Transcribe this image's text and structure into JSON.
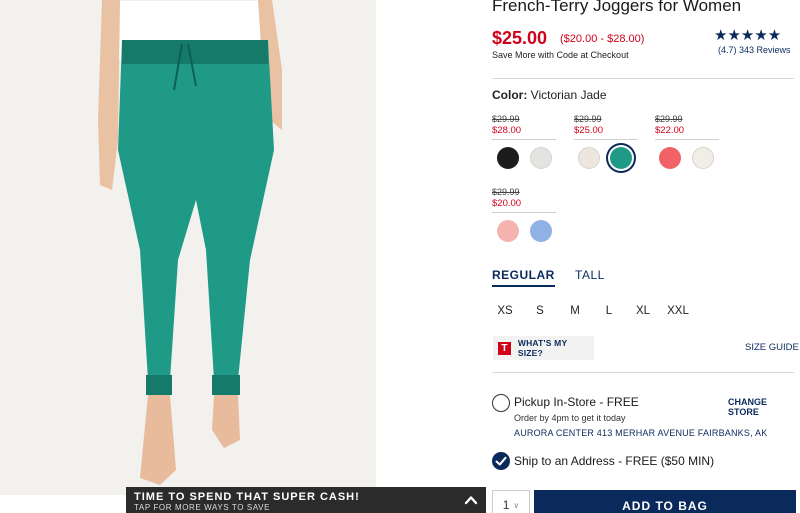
{
  "product": {
    "title": "French-Terry Joggers for Women",
    "price": "$25.00",
    "price_range": "($20.00 - $28.00)",
    "promo_text": "Save More with Code at Checkout",
    "rating_stars": "★★★★★",
    "reviews": "(4.7) 343 Reviews"
  },
  "color": {
    "label": "Color:",
    "value": "Victorian Jade",
    "price_groups": [
      {
        "old": "$29.99",
        "new": "$28.00"
      },
      {
        "old": "$29.99",
        "new": "$25.00"
      },
      {
        "old": "$29.99",
        "new": "$22.00"
      },
      {
        "old": "$29.99",
        "new": "$20.00"
      }
    ],
    "swatches": [
      {
        "name": "black",
        "color": "#1c1c1c"
      },
      {
        "name": "light-grey",
        "color": "#e3e3e1"
      },
      {
        "name": "oatmeal",
        "color": "#ece6df"
      },
      {
        "name": "victorian-jade",
        "color": "#1f9a86",
        "selected": true
      },
      {
        "name": "coral",
        "color": "#f16266"
      },
      {
        "name": "cream",
        "color": "#f1eee7"
      },
      {
        "name": "pink",
        "color": "#f5b3b0"
      },
      {
        "name": "blue",
        "color": "#8fb1e3"
      }
    ]
  },
  "fit_tabs": [
    {
      "label": "REGULAR",
      "active": true
    },
    {
      "label": "TALL",
      "active": false
    }
  ],
  "sizes": [
    "XS",
    "S",
    "M",
    "L",
    "XL",
    "XXL"
  ],
  "whats_my_size": {
    "icon_letter": "T",
    "label": "WHAT'S MY SIZE?"
  },
  "size_guide": "SIZE GUIDE",
  "pickup": {
    "label": "Pickup In-Store - FREE",
    "change_store": "CHANGE STORE",
    "order_by": "Order by 4pm to get it today",
    "address": "AURORA CENTER 413 MERHAR AVENUE  FAIRBANKS, AK"
  },
  "ship": {
    "label": "Ship to an Address - FREE ($50 MIN)"
  },
  "quantity": "1",
  "add_to_bag": "ADD TO BAG",
  "promo_banner": {
    "title": "TIME TO SPEND THAT SUPER CASH!",
    "subtitle": "TAP FOR MORE WAYS TO SAVE"
  },
  "colors": {
    "navy": "#0b2a5c",
    "sale_red": "#d0021b",
    "banner": "#2b2b2b"
  }
}
